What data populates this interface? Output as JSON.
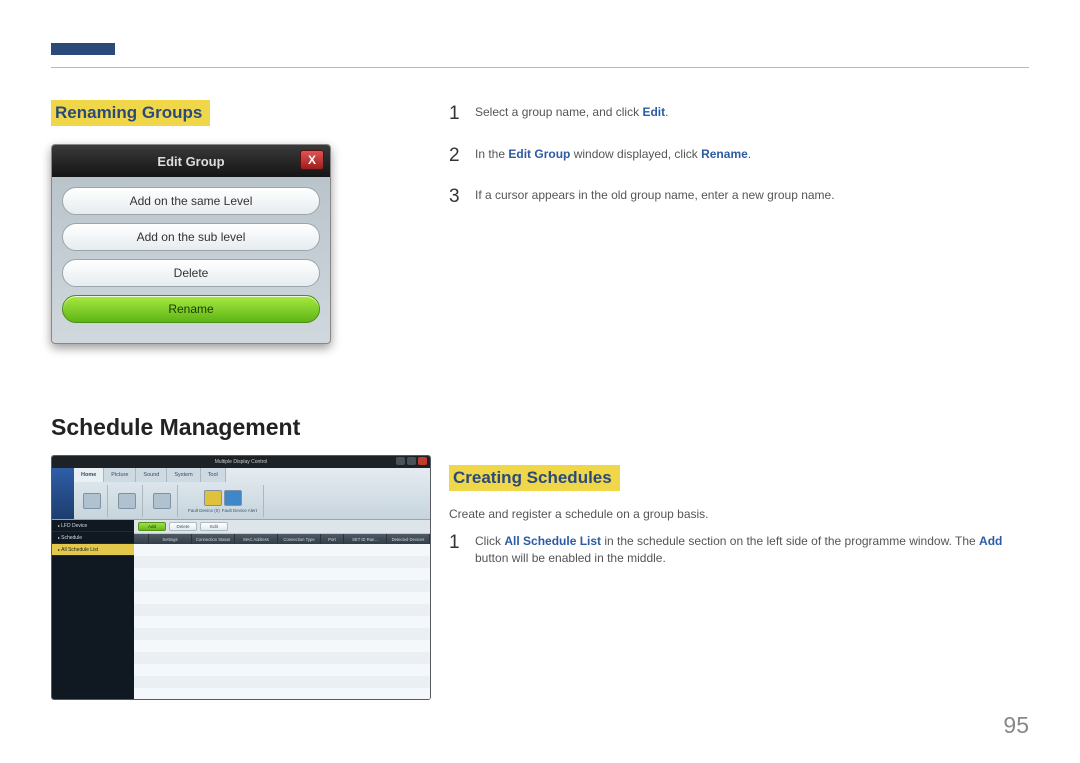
{
  "page_number": "95",
  "sections": {
    "renaming_groups": {
      "heading": "Renaming Groups"
    },
    "schedule_management": {
      "heading": "Schedule Management"
    },
    "creating_schedules": {
      "heading": "Creating Schedules",
      "intro": "Create and register a schedule on a group basis."
    }
  },
  "edit_group_dialog": {
    "title": "Edit Group",
    "close_label": "X",
    "buttons": {
      "add_same": "Add on the same Level",
      "add_sub": "Add on the sub level",
      "delete": "Delete",
      "rename": "Rename"
    }
  },
  "mdc_window": {
    "title": "Multiple Display Control",
    "tabs": [
      "Home",
      "Picture",
      "Sound",
      "System",
      "Tool"
    ],
    "ribbon": {
      "fault_device": "Fault Device (0)",
      "fault_alert": "Fault Device Alert"
    },
    "sidebar": {
      "lfd": "LFD Device",
      "schedule": "Schedule",
      "all_list": "All Schedule List"
    },
    "toolbar": {
      "add": "Add",
      "delete": "Delete",
      "edit": "Edit"
    },
    "columns": [
      "",
      "Settings",
      "Connection Status",
      "MAC Address",
      "Connection Type",
      "Port",
      "SET ID Ran...",
      "Detected Devices"
    ]
  },
  "steps_renaming": {
    "s1_pre": "Select a group name, and click ",
    "s1_kw": "Edit",
    "s1_post": ".",
    "s2_pre": "In the ",
    "s2_kw1": "Edit Group",
    "s2_mid": " window displayed, click ",
    "s2_kw2": "Rename",
    "s2_post": ".",
    "s3": "If a cursor appears in the old group name, enter a new group name."
  },
  "steps_creating": {
    "s1_pre": "Click ",
    "s1_kw1": "All Schedule List",
    "s1_mid": " in the schedule section on the left side of the programme window. The ",
    "s1_kw2": "Add",
    "s1_post": " button will be enabled in the middle."
  }
}
